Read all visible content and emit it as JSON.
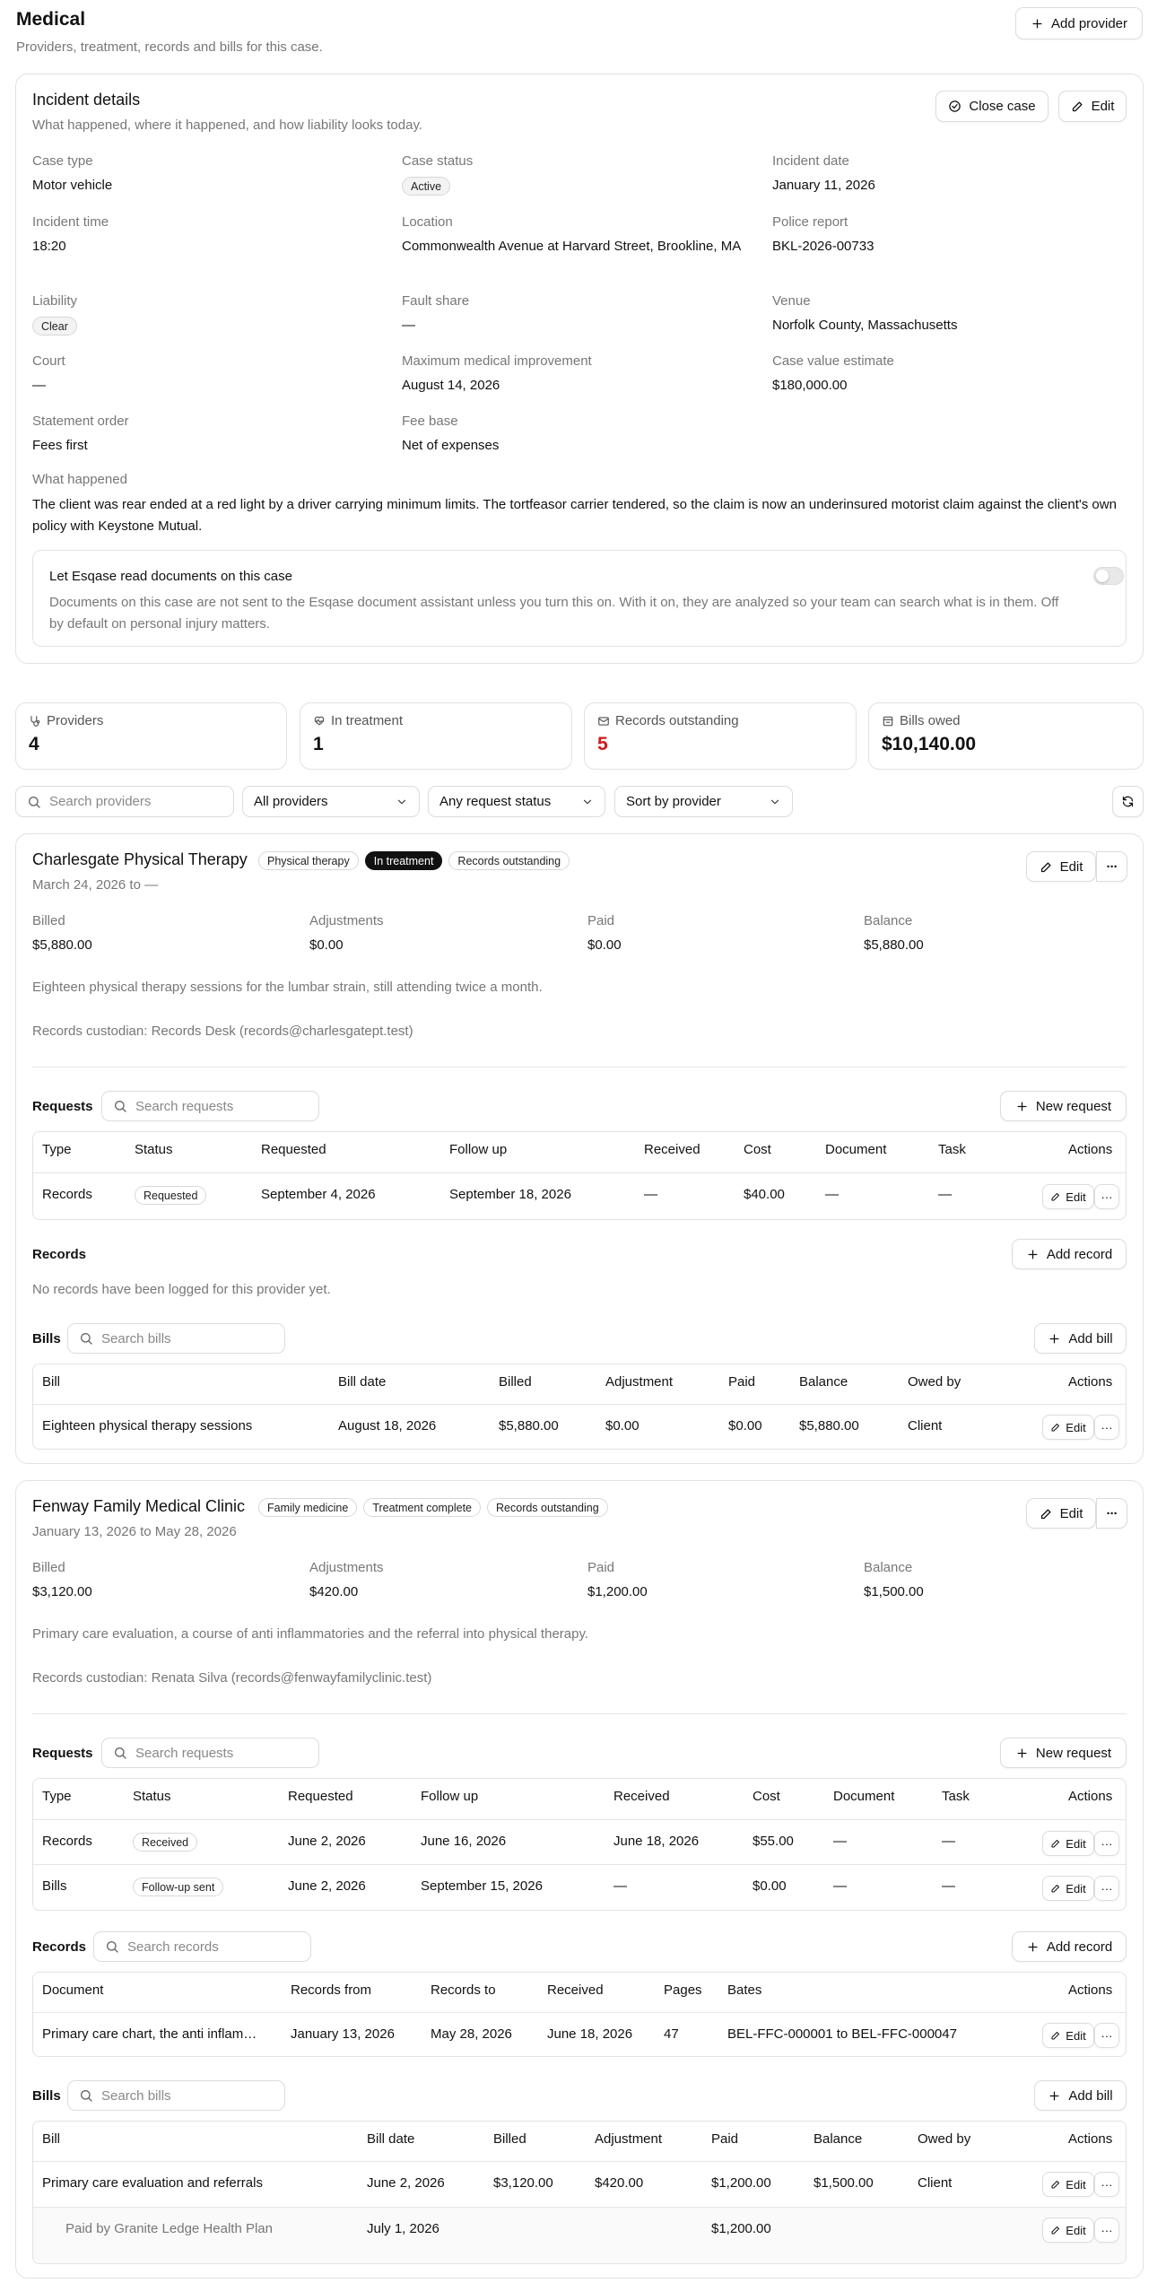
{
  "page": {
    "title": "Medical",
    "subtitle": "Providers, treatment, records and bills for this case.",
    "add_provider": "Add provider"
  },
  "incident": {
    "title": "Incident details",
    "subtitle": "What happened, where it happened, and how liability looks today.",
    "close_case": "Close case",
    "edit": "Edit",
    "fields": {
      "case_type": {
        "label": "Case type",
        "value": "Motor vehicle"
      },
      "case_status": {
        "label": "Case status",
        "value": "Active"
      },
      "incident_date": {
        "label": "Incident date",
        "value": "January 11, 2026"
      },
      "incident_time": {
        "label": "Incident time",
        "value": "18:20"
      },
      "location": {
        "label": "Location",
        "value": "Commonwealth Avenue at Harvard Street, Brookline, MA"
      },
      "police_report": {
        "label": "Police report",
        "value": "BKL-2026-00733"
      },
      "liability": {
        "label": "Liability",
        "value": "Clear"
      },
      "fault_share": {
        "label": "Fault share",
        "value": "—"
      },
      "venue": {
        "label": "Venue",
        "value": "Norfolk County, Massachusetts"
      },
      "court": {
        "label": "Court",
        "value": "—"
      },
      "mmi": {
        "label": "Maximum medical improvement",
        "value": "August 14, 2026"
      },
      "case_value": {
        "label": "Case value estimate",
        "value": "$180,000.00"
      },
      "statement_order": {
        "label": "Statement order",
        "value": "Fees first"
      },
      "fee_base": {
        "label": "Fee base",
        "value": "Net of expenses"
      }
    },
    "what_happened_label": "What happened",
    "what_happened": "The client was rear ended at a red light by a driver carrying minimum limits. The tortfeasor carrier tendered, so the claim is now an underinsured motorist claim against the client's own policy with Keystone Mutual.",
    "ai_toggle": {
      "title": "Let Esqase read documents on this case",
      "description": "Documents on this case are not sent to the Esqase document assistant unless you turn this on. With it on, they are analyzed so your team can search what is in them. Off by default on personal injury matters.",
      "enabled": false
    }
  },
  "stats": [
    {
      "label": "Providers",
      "value": "4",
      "icon": "stethoscope-icon"
    },
    {
      "label": "In treatment",
      "value": "1",
      "icon": "heart-pulse-icon"
    },
    {
      "label": "Records outstanding",
      "value": "5",
      "icon": "mail-icon",
      "color": "#d0191d"
    },
    {
      "label": "Bills owed",
      "value": "$10,140.00",
      "icon": "receipt-icon"
    }
  ],
  "filters": {
    "search_placeholder": "Search providers",
    "provider_filter": "All providers",
    "status_filter": "Any request status",
    "sort": "Sort by provider"
  },
  "common": {
    "edit": "Edit",
    "more": "···",
    "requests": "Requests",
    "records": "Records",
    "bills": "Bills",
    "new_request": "New request",
    "add_record": "Add record",
    "add_bill": "Add bill",
    "search_requests": "Search requests",
    "search_records": "Search records",
    "search_bills": "Search bills",
    "billed": "Billed",
    "adjustments": "Adjustments",
    "paid": "Paid",
    "balance": "Balance"
  },
  "request_columns": [
    "Type",
    "Status",
    "Requested",
    "Follow up",
    "Received",
    "Cost",
    "Document",
    "Task",
    "Actions"
  ],
  "record_columns": [
    "Document",
    "Records from",
    "Records to",
    "Received",
    "Pages",
    "Bates",
    "Actions"
  ],
  "bill_columns": [
    "Bill",
    "Bill date",
    "Billed",
    "Adjustment",
    "Paid",
    "Balance",
    "Owed by",
    "Actions"
  ],
  "providers": [
    {
      "name": "Charlesgate Physical Therapy",
      "badges": [
        "Physical therapy",
        "In treatment",
        "Records outstanding"
      ],
      "dates": "March 24, 2026 to —",
      "billed": "$5,880.00",
      "adjustments": "$0.00",
      "paid": "$0.00",
      "balance": "$5,880.00",
      "notes": "Eighteen physical therapy sessions for the lumbar strain, still attending twice a month.",
      "custodian": "Records custodian: Records Desk (records@charlesgatept.test)",
      "requests": [
        {
          "type": "Records",
          "status": "Requested",
          "requested": "September 4, 2026",
          "follow_up": "September 18, 2026",
          "received": "—",
          "cost": "$40.00",
          "document": "—",
          "task": "—"
        }
      ],
      "records_empty": "No records have been logged for this provider yet.",
      "bills": [
        {
          "bill": "Eighteen physical therapy sessions",
          "date": "August 18, 2026",
          "billed": "$5,880.00",
          "adjustment": "$0.00",
          "paid": "$0.00",
          "balance": "$5,880.00",
          "owed_by": "Client"
        }
      ]
    },
    {
      "name": "Fenway Family Medical Clinic",
      "badges": [
        "Family medicine",
        "Treatment complete",
        "Records outstanding"
      ],
      "dates": "January 13, 2026 to May 28, 2026",
      "billed": "$3,120.00",
      "adjustments": "$420.00",
      "paid": "$1,200.00",
      "balance": "$1,500.00",
      "notes": "Primary care evaluation, a course of anti inflammatories and the referral into physical therapy.",
      "custodian": "Records custodian: Renata Silva (records@fenwayfamilyclinic.test)",
      "requests": [
        {
          "type": "Records",
          "status": "Received",
          "requested": "June 2, 2026",
          "follow_up": "June 16, 2026",
          "received": "June 18, 2026",
          "cost": "$55.00",
          "document": "—",
          "task": "—"
        },
        {
          "type": "Bills",
          "status": "Follow-up sent",
          "requested": "June 2, 2026",
          "follow_up": "September 15, 2026",
          "received": "—",
          "cost": "$0.00",
          "document": "—",
          "task": "—"
        }
      ],
      "records": [
        {
          "document": "Primary care chart, the anti inflam…",
          "from": "January 13, 2026",
          "to": "May 28, 2026",
          "received": "June 18, 2026",
          "pages": "47",
          "bates": "BEL-FFC-000001 to BEL-FFC-000047"
        }
      ],
      "bills": [
        {
          "bill": "Primary care evaluation and referrals",
          "date": "June 2, 2026",
          "billed": "$3,120.00",
          "adjustment": "$420.00",
          "paid": "$1,200.00",
          "balance": "$1,500.00",
          "owed_by": "Client"
        }
      ],
      "payment": {
        "label": "Paid by Granite Ledge Health Plan",
        "date": "July 1, 2026",
        "paid": "$1,200.00"
      }
    }
  ]
}
